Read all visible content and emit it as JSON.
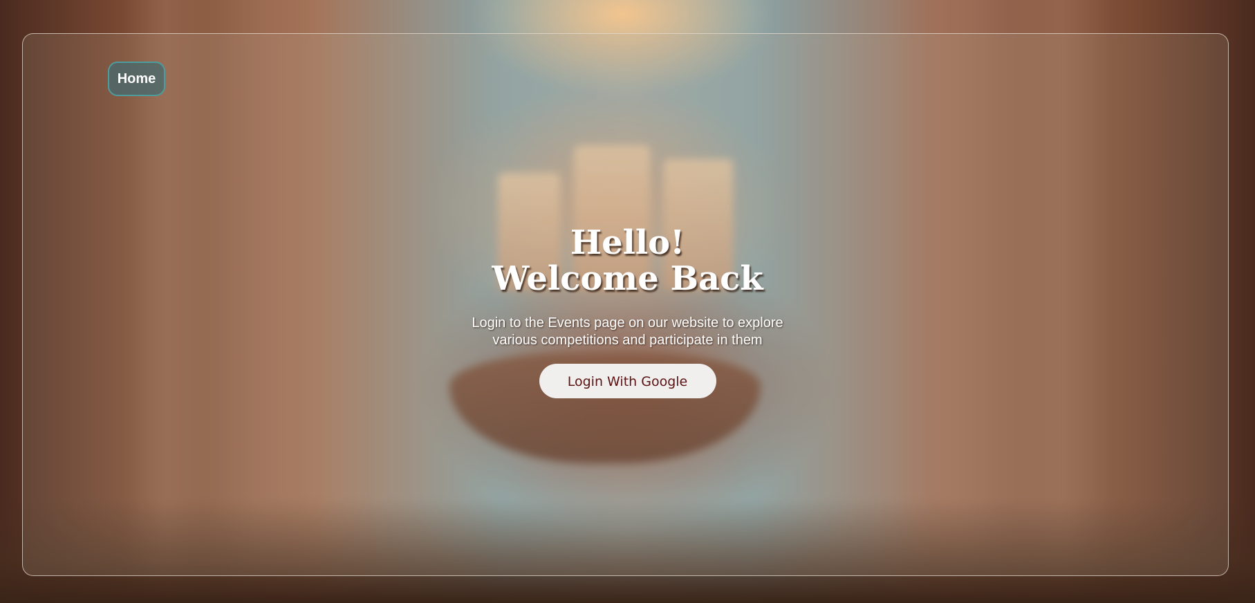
{
  "nav": {
    "home_label": "Home"
  },
  "hero": {
    "title_line1": "Hello!",
    "title_line2": "Welcome Back",
    "subtitle_line1": "Login to the Events page on our website to explore",
    "subtitle_line2": "various competitions and participate in them",
    "login_button_label": "Login With Google"
  },
  "colors": {
    "home_border": "#4f9c9e",
    "login_text": "#5a1212",
    "login_bg": "#f1eeee"
  }
}
